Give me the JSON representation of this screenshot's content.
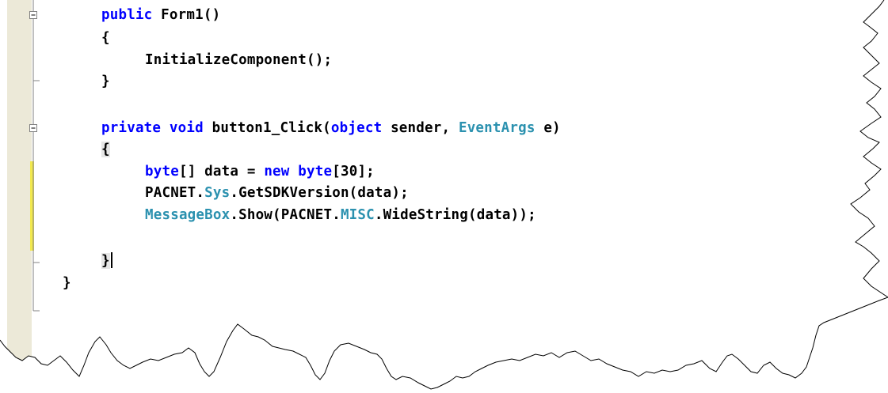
{
  "code": {
    "line1": {
      "kw": "public",
      "rest": " Form1()"
    },
    "line2": {
      "text": "{"
    },
    "line3": {
      "text": "InitializeComponent();"
    },
    "line4": {
      "text": "}"
    },
    "line5": {
      "kw1": "private",
      "kw2": "void",
      "mid": " button1_Click(",
      "kw3": "object",
      "mid2": " sender, ",
      "type1": "EventArgs",
      "rest": " e)"
    },
    "line6": {
      "text": "{"
    },
    "line7": {
      "kw1": "byte",
      "mid": "[] data = ",
      "kw2": "new",
      "kw3": "byte",
      "rest": "[30];"
    },
    "line8": {
      "pre": "PACNET.",
      "type1": "Sys",
      "rest": ".GetSDKVersion(data);"
    },
    "line9": {
      "type1": "MessageBox",
      "mid": ".Show(PACNET.",
      "type2": "MISC",
      "rest": ".WideString(data));"
    },
    "line11": {
      "text": "}"
    },
    "line12": {
      "text": "}"
    }
  },
  "colors": {
    "keyword": "#0000FF",
    "type": "#2B91AF",
    "text": "#000000",
    "margin": "#ECE9D8",
    "change_bar": "#F2E94E"
  }
}
